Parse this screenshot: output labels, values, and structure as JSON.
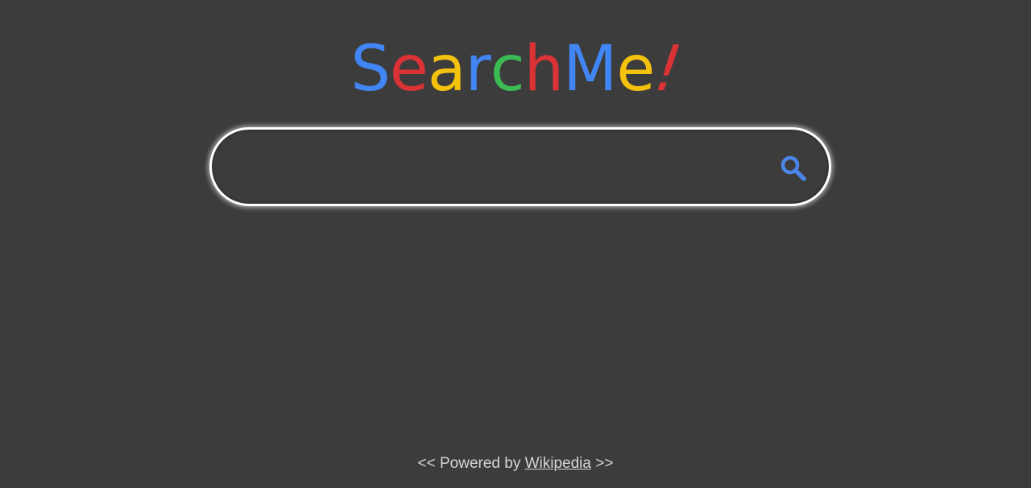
{
  "logo": {
    "letters": [
      {
        "char": "S",
        "color": "#4285f4"
      },
      {
        "char": "e",
        "color": "#db3236"
      },
      {
        "char": "a",
        "color": "#f4c20d"
      },
      {
        "char": "r",
        "color": "#4285f4"
      },
      {
        "char": "c",
        "color": "#3cba54"
      },
      {
        "char": "h",
        "color": "#db3236"
      },
      {
        "char": "M",
        "color": "#4285f4"
      },
      {
        "char": "e",
        "color": "#f4c20d"
      },
      {
        "char": "!",
        "color": "#db3236"
      }
    ]
  },
  "search": {
    "value": "",
    "placeholder": "",
    "icon": "search-icon",
    "icon_color": "#4a86e8",
    "border_color": "#ffffff"
  },
  "footer": {
    "prefix": "<< Powered by",
    "link_label": "Wikipedia",
    "suffix": ">>"
  },
  "colors": {
    "background": "#3c3c3c",
    "footer_text": "#d4d4d4"
  }
}
